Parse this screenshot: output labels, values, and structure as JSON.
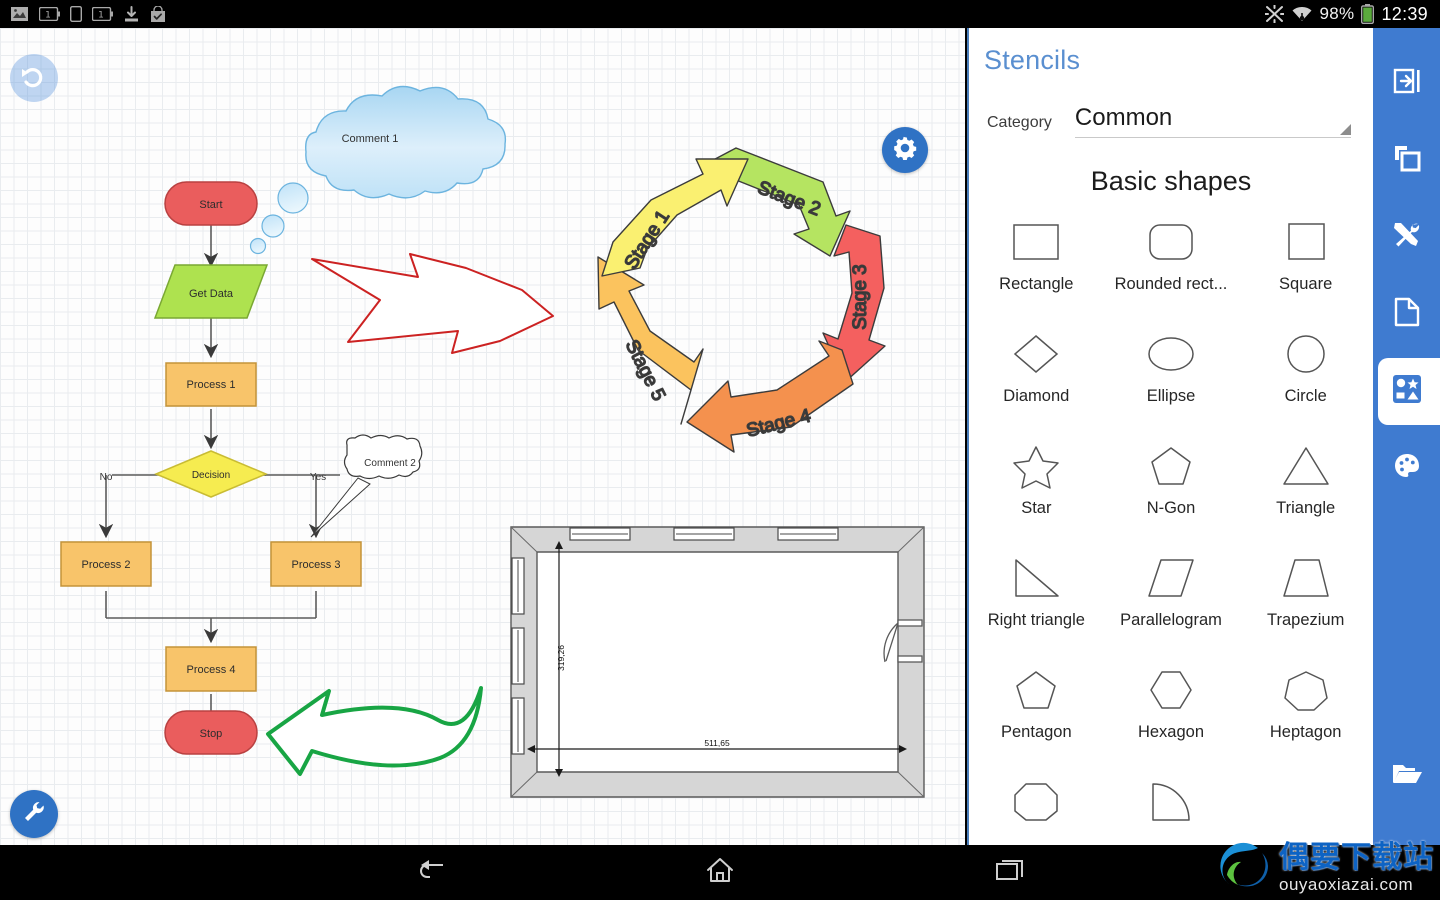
{
  "statusbar": {
    "left_icons": [
      "gallery-icon",
      "battery-saver-icon",
      "sim-card-icon",
      "battery-badge-icon",
      "download-icon",
      "checked-bag-icon"
    ],
    "right_icons": [
      "bluetooth-off-icon",
      "wifi-icon"
    ],
    "battery_percent": "98%",
    "time": "12:39"
  },
  "canvas": {
    "undo_label": "undo-icon",
    "tools_label": "tools-icon",
    "gear_label": "settings-icon",
    "flowchart": {
      "nodes": [
        {
          "id": "start",
          "label": "Start",
          "shape": "terminator",
          "color": "#ea5d5d"
        },
        {
          "id": "getdata",
          "label": "Get Data",
          "shape": "parallelogram",
          "color": "#aee24f"
        },
        {
          "id": "process1",
          "label": "Process 1",
          "shape": "rect",
          "color": "#f8c46a"
        },
        {
          "id": "decision",
          "label": "Decision",
          "shape": "diamond",
          "color": "#f6ec50"
        },
        {
          "id": "process2",
          "label": "Process 2",
          "shape": "rect",
          "color": "#f8c46a"
        },
        {
          "id": "process3",
          "label": "Process 3",
          "shape": "rect",
          "color": "#f8c46a"
        },
        {
          "id": "process4",
          "label": "Process 4",
          "shape": "rect",
          "color": "#f8c46a"
        },
        {
          "id": "stop",
          "label": "Stop",
          "shape": "terminator",
          "color": "#ea5d5d"
        }
      ],
      "edge_labels": {
        "no": "No",
        "yes": "Yes"
      },
      "comment1": "Comment 1",
      "comment2": "Comment 2"
    },
    "cycle": {
      "stages": [
        {
          "label": "Stage 1",
          "color": "#faf071"
        },
        {
          "label": "Stage 2",
          "color": "#b5e461"
        },
        {
          "label": "Stage 3",
          "color": "#f4605f"
        },
        {
          "label": "Stage 4",
          "color": "#f4914e"
        },
        {
          "label": "Stage 5",
          "color": "#fbc35e"
        }
      ]
    },
    "floorplan": {
      "height_dim": "319,26",
      "width_dim": "511,65"
    },
    "annotations": {
      "red_arrow": "red-block-arrow",
      "green_arrow": "green-curved-arrow"
    }
  },
  "stencils": {
    "title": "Stencils",
    "category_label": "Category",
    "category_value": "Common",
    "group_title": "Basic shapes",
    "shapes": [
      {
        "label": "Rectangle",
        "icon": "rectangle-shape"
      },
      {
        "label": "Rounded rect...",
        "icon": "rounded-rectangle-shape"
      },
      {
        "label": "Square",
        "icon": "square-shape"
      },
      {
        "label": "Diamond",
        "icon": "diamond-shape"
      },
      {
        "label": "Ellipse",
        "icon": "ellipse-shape"
      },
      {
        "label": "Circle",
        "icon": "circle-shape"
      },
      {
        "label": "Star",
        "icon": "star-shape"
      },
      {
        "label": "N-Gon",
        "icon": "ngon-shape"
      },
      {
        "label": "Triangle",
        "icon": "triangle-shape"
      },
      {
        "label": "Right triangle",
        "icon": "right-triangle-shape"
      },
      {
        "label": "Parallelogram",
        "icon": "parallelogram-shape"
      },
      {
        "label": "Trapezium",
        "icon": "trapezium-shape"
      },
      {
        "label": "Pentagon",
        "icon": "pentagon-shape"
      },
      {
        "label": "Hexagon",
        "icon": "hexagon-shape"
      },
      {
        "label": "Heptagon",
        "icon": "heptagon-shape"
      },
      {
        "label": "",
        "icon": "octagon-shape"
      },
      {
        "label": "",
        "icon": "quarter-circle-shape"
      },
      {
        "label": "",
        "icon": "blank-shape"
      }
    ]
  },
  "toolbar": {
    "items": [
      {
        "name": "collapse-panel-icon",
        "active": false
      },
      {
        "name": "layers-icon",
        "active": false
      },
      {
        "name": "tools-icon",
        "active": false
      },
      {
        "name": "page-icon",
        "active": false
      },
      {
        "name": "shapes-icon",
        "active": true
      },
      {
        "name": "palette-icon",
        "active": false
      }
    ],
    "bottom_item": {
      "name": "open-folder-icon"
    }
  },
  "navbar": {
    "back": "back-icon",
    "home": "home-icon",
    "recents": "recents-icon"
  },
  "watermark": {
    "cn": "偶要下载站",
    "en": "ouyaoxiazai.com"
  },
  "colors": {
    "accent_blue": "#3f7bd0",
    "panel_border": "#4a7ebb",
    "title_blue": "#5a8fd0"
  }
}
